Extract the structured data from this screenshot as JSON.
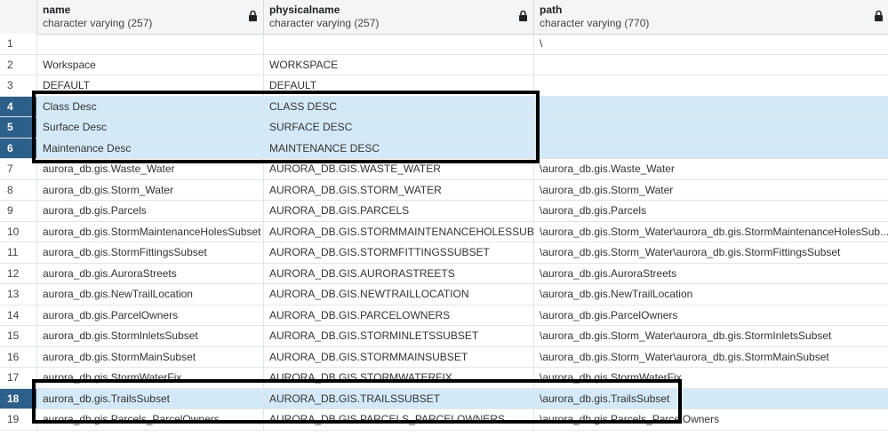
{
  "columns": [
    {
      "name": "name",
      "type": "character varying (257)"
    },
    {
      "name": "physicalname",
      "type": "character varying (257)"
    },
    {
      "name": "path",
      "type": "character varying (770)"
    }
  ],
  "rows": [
    {
      "num": "1",
      "name": "",
      "physicalname": "",
      "path": "\\",
      "selected": false
    },
    {
      "num": "2",
      "name": "Workspace",
      "physicalname": "WORKSPACE",
      "path": "",
      "selected": false
    },
    {
      "num": "3",
      "name": "DEFAULT",
      "physicalname": "DEFAULT",
      "path": "",
      "selected": false
    },
    {
      "num": "4",
      "name": "Class Desc",
      "physicalname": "CLASS DESC",
      "path": "",
      "selected": true
    },
    {
      "num": "5",
      "name": "Surface Desc",
      "physicalname": "SURFACE DESC",
      "path": "",
      "selected": true
    },
    {
      "num": "6",
      "name": "Maintenance Desc",
      "physicalname": "MAINTENANCE DESC",
      "path": "",
      "selected": true
    },
    {
      "num": "7",
      "name": "aurora_db.gis.Waste_Water",
      "physicalname": "AURORA_DB.GIS.WASTE_WATER",
      "path": "\\aurora_db.gis.Waste_Water",
      "selected": false
    },
    {
      "num": "8",
      "name": "aurora_db.gis.Storm_Water",
      "physicalname": "AURORA_DB.GIS.STORM_WATER",
      "path": "\\aurora_db.gis.Storm_Water",
      "selected": false
    },
    {
      "num": "9",
      "name": "aurora_db.gis.Parcels",
      "physicalname": "AURORA_DB.GIS.PARCELS",
      "path": "\\aurora_db.gis.Parcels",
      "selected": false
    },
    {
      "num": "10",
      "name": "aurora_db.gis.StormMaintenanceHolesSubset",
      "physicalname": "AURORA_DB.GIS.STORMMAINTENANCEHOLESSUBSET",
      "path": "\\aurora_db.gis.Storm_Water\\aurora_db.gis.StormMaintenanceHolesSub...",
      "selected": false
    },
    {
      "num": "11",
      "name": "aurora_db.gis.StormFittingsSubset",
      "physicalname": "AURORA_DB.GIS.STORMFITTINGSSUBSET",
      "path": "\\aurora_db.gis.Storm_Water\\aurora_db.gis.StormFittingsSubset",
      "selected": false
    },
    {
      "num": "12",
      "name": "aurora_db.gis.AuroraStreets",
      "physicalname": "AURORA_DB.GIS.AURORASTREETS",
      "path": "\\aurora_db.gis.AuroraStreets",
      "selected": false
    },
    {
      "num": "13",
      "name": "aurora_db.gis.NewTrailLocation",
      "physicalname": "AURORA_DB.GIS.NEWTRAILLOCATION",
      "path": "\\aurora_db.gis.NewTrailLocation",
      "selected": false
    },
    {
      "num": "14",
      "name": "aurora_db.gis.ParcelOwners",
      "physicalname": "AURORA_DB.GIS.PARCELOWNERS",
      "path": "\\aurora_db.gis.ParcelOwners",
      "selected": false
    },
    {
      "num": "15",
      "name": "aurora_db.gis.StormInletsSubset",
      "physicalname": "AURORA_DB.GIS.STORMINLETSSUBSET",
      "path": "\\aurora_db.gis.Storm_Water\\aurora_db.gis.StormInletsSubset",
      "selected": false
    },
    {
      "num": "16",
      "name": "aurora_db.gis.StormMainSubset",
      "physicalname": "AURORA_DB.GIS.STORMMAINSUBSET",
      "path": "\\aurora_db.gis.Storm_Water\\aurora_db.gis.StormMainSubset",
      "selected": false
    },
    {
      "num": "17",
      "name": "aurora_db.gis.StormWaterFix",
      "physicalname": "AURORA_DB.GIS.STORMWATERFIX",
      "path": "\\aurora_db.gis.StormWaterFix",
      "selected": false
    },
    {
      "num": "18",
      "name": "aurora_db.gis.TrailsSubset",
      "physicalname": "AURORA_DB.GIS.TRAILSSUBSET",
      "path": "\\aurora_db.gis.TrailsSubset",
      "selected": true
    },
    {
      "num": "19",
      "name": "aurora_db.gis.Parcels_ParcelOwners",
      "physicalname": "AURORA_DB.GIS.PARCELS_PARCELOWNERS",
      "path": "\\aurora_db.gis.Parcels_ParcelOwners",
      "selected": false
    }
  ],
  "colors": {
    "selected_row": "#d4e9f7",
    "selected_rownum": "#2c5f8a",
    "annotation_box": "#000000"
  }
}
